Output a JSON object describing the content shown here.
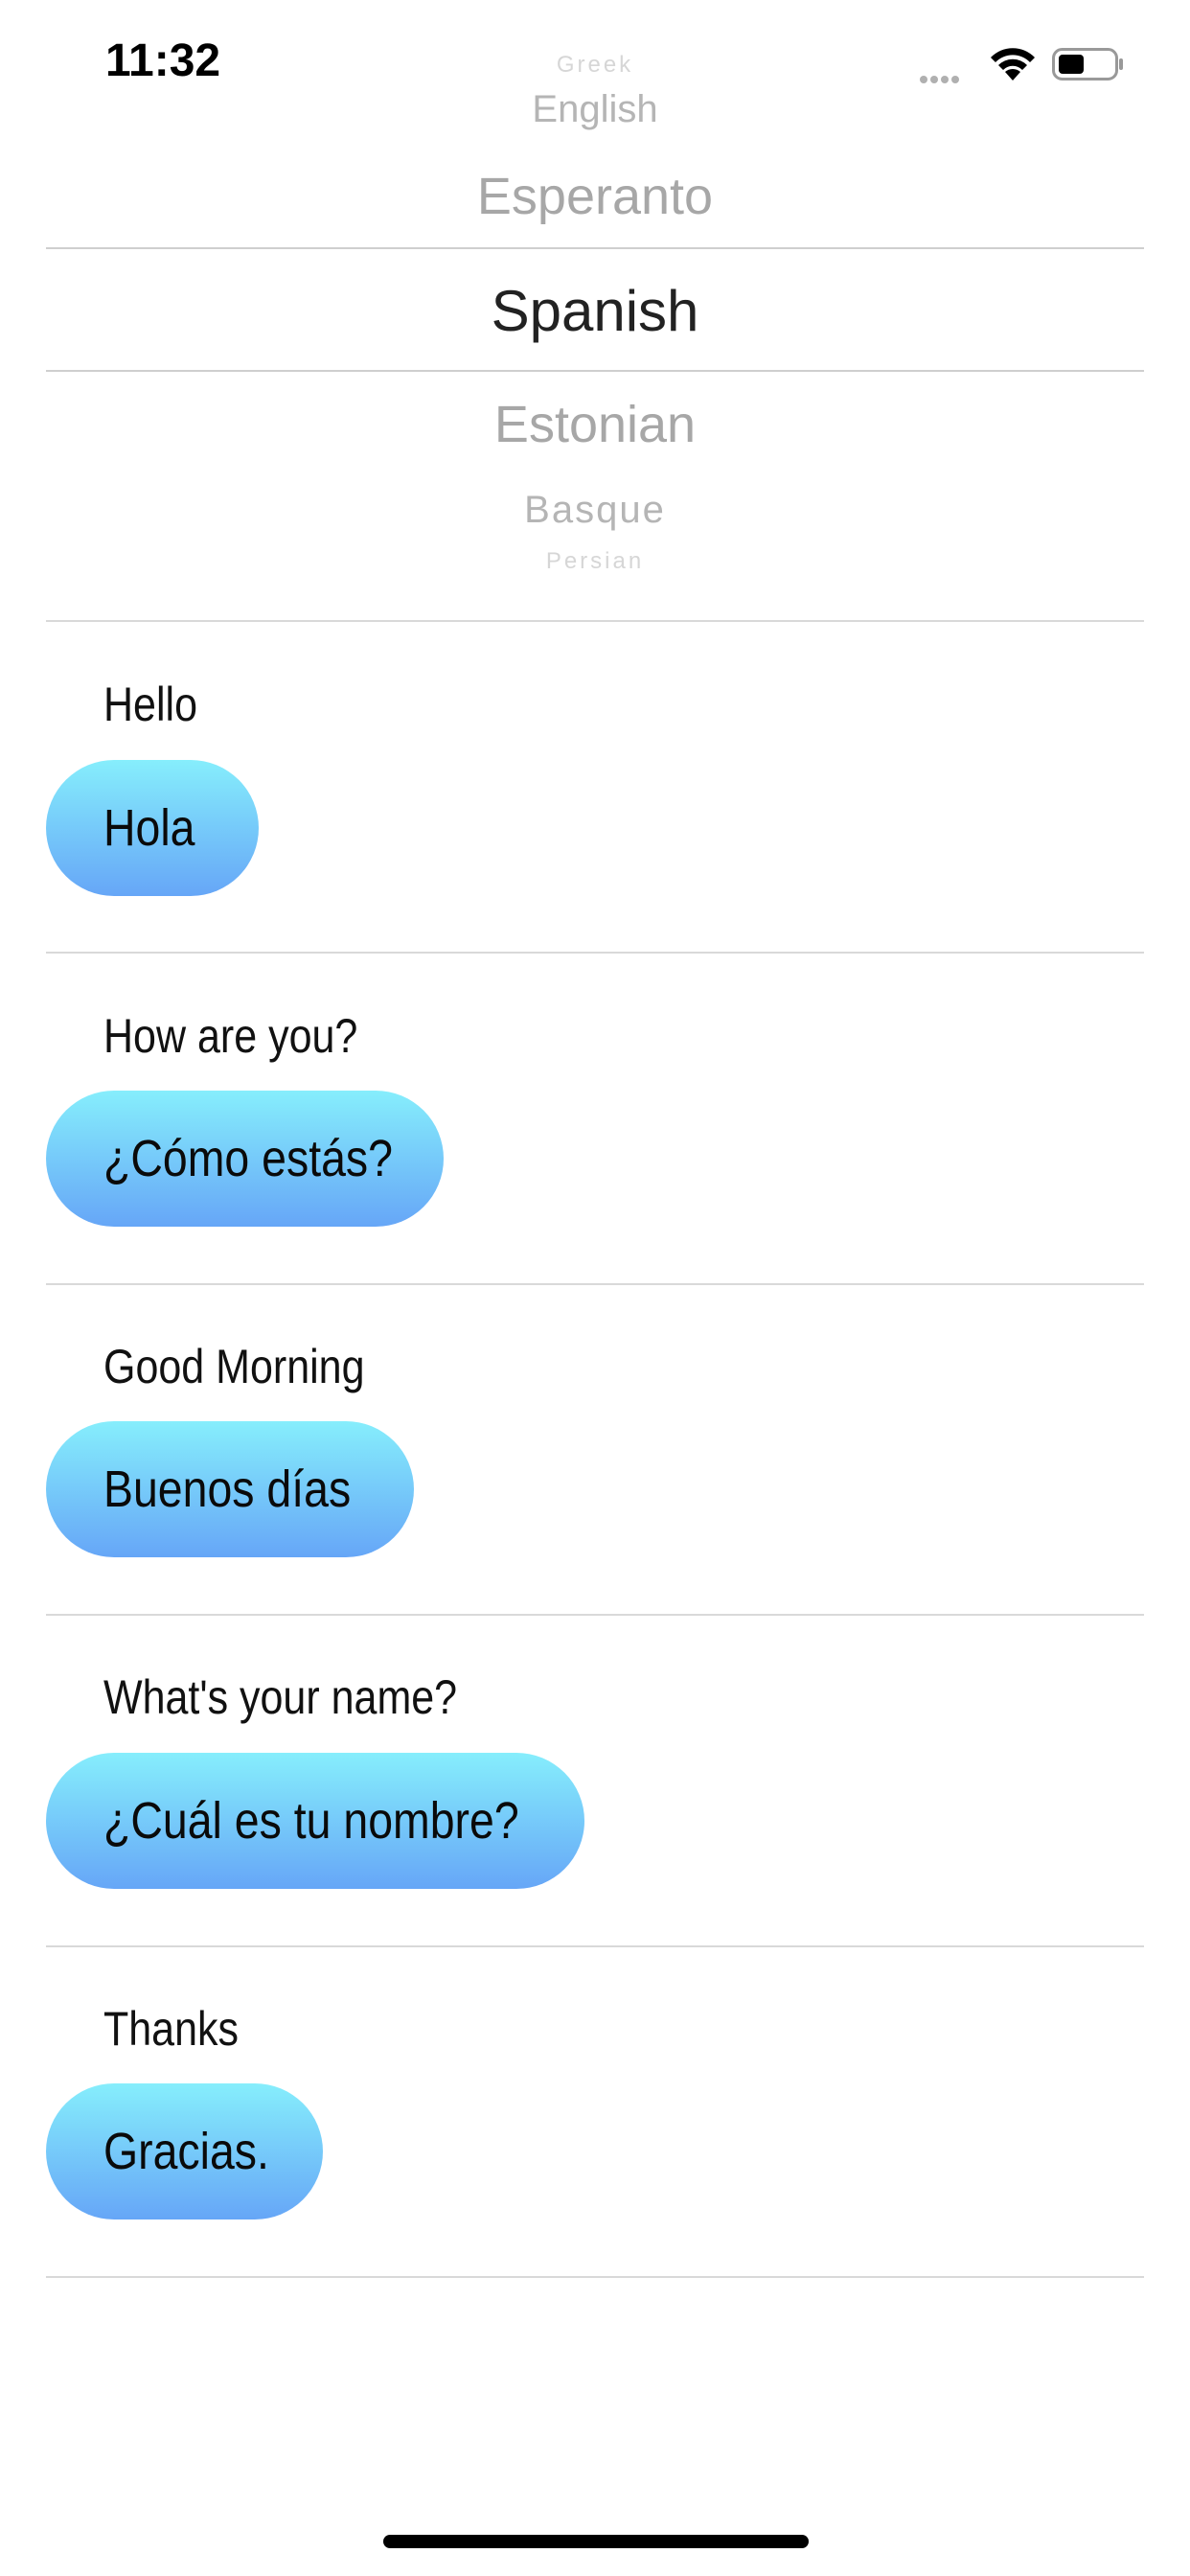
{
  "status_bar": {
    "time": "11:32"
  },
  "language_picker": {
    "selected": "Spanish",
    "options": [
      "Greek",
      "English",
      "Esperanto",
      "Spanish",
      "Estonian",
      "Basque",
      "Persian"
    ]
  },
  "phrases": [
    {
      "original": "Hello",
      "translation": "Hola"
    },
    {
      "original": "How are you?",
      "translation": "¿Cómo estás?"
    },
    {
      "original": "Good Morning",
      "translation": "Buenos días"
    },
    {
      "original": "What's your name?",
      "translation": "¿Cuál es tu nombre?"
    },
    {
      "original": "Thanks",
      "translation": "Gracias."
    }
  ],
  "colors": {
    "bubble_top": "#86eefc",
    "bubble_bottom": "#66a6f7",
    "picker_unselected": "#a7a7a7",
    "picker_selected": "#222222"
  }
}
